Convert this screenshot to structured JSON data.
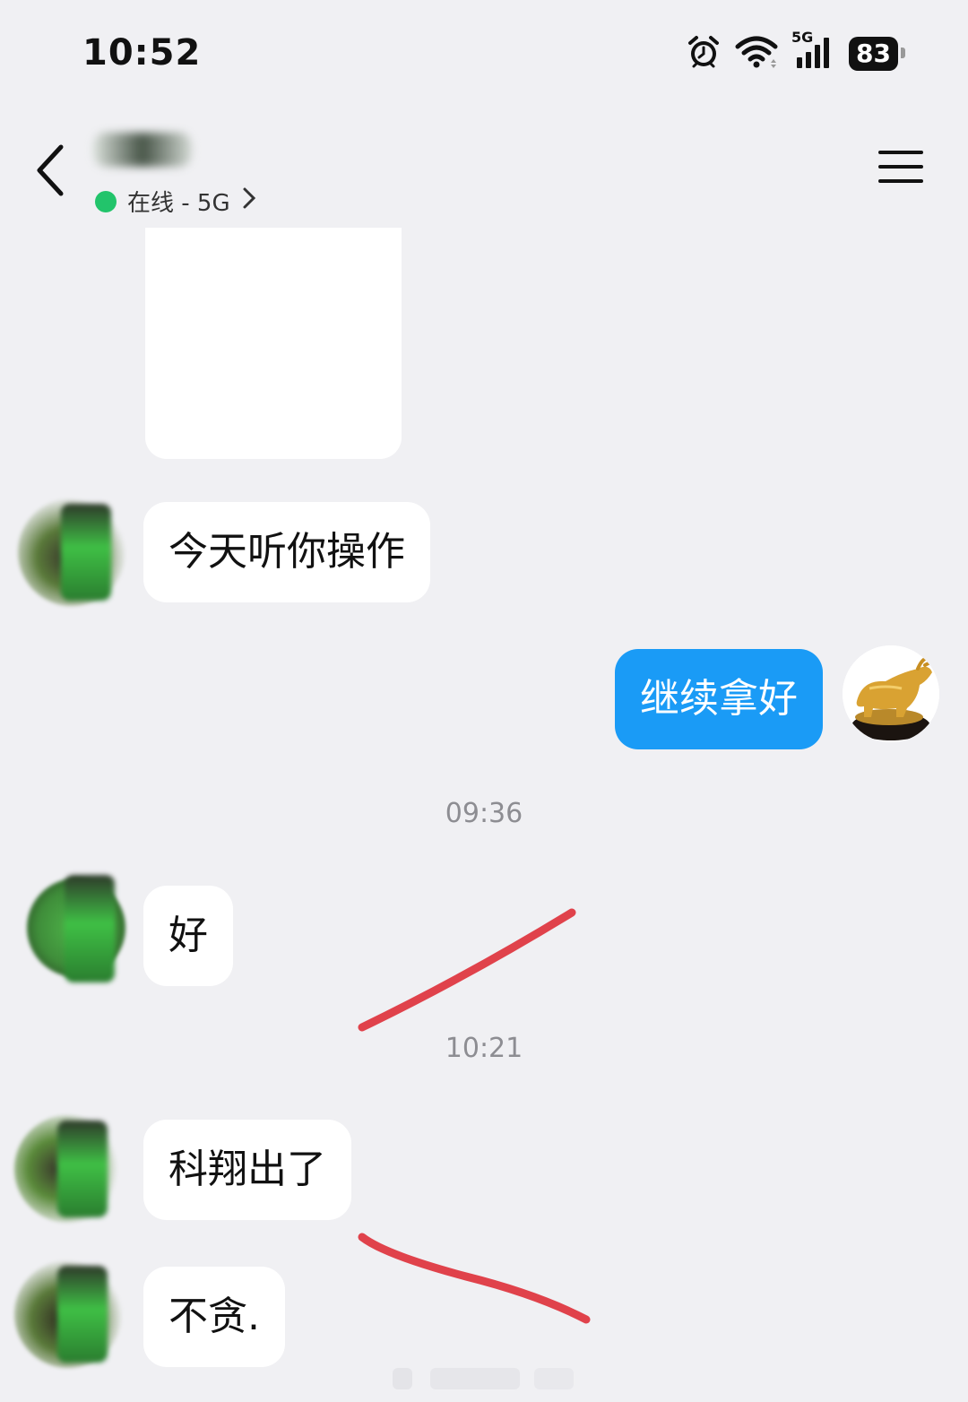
{
  "status_bar": {
    "time": "10:52",
    "network": "5G",
    "battery": "83",
    "icons": [
      "alarm-icon",
      "wifi-icon",
      "cellular-signal-icon",
      "battery-icon"
    ]
  },
  "nav": {
    "presence_text": "在线 - 5G",
    "presence_color": "#22c46b",
    "icons": [
      "back-arrow-icon",
      "chevron-right-icon",
      "menu-icon"
    ]
  },
  "messages": [
    {
      "sender": "contact",
      "text": "今天听你操作"
    },
    {
      "sender": "self",
      "text": "继续拿好"
    },
    {
      "type": "timestamp",
      "text": "09:36"
    },
    {
      "sender": "contact",
      "text": "好"
    },
    {
      "type": "timestamp",
      "text": "10:21"
    },
    {
      "sender": "contact",
      "text": "科翔出了"
    },
    {
      "sender": "contact",
      "text": "不贪."
    }
  ],
  "colors": {
    "background": "#f0f0f3",
    "self_bubble": "#1a9bf6",
    "contact_bubble": "#ffffff",
    "annotation_stroke": "#e0424b"
  }
}
